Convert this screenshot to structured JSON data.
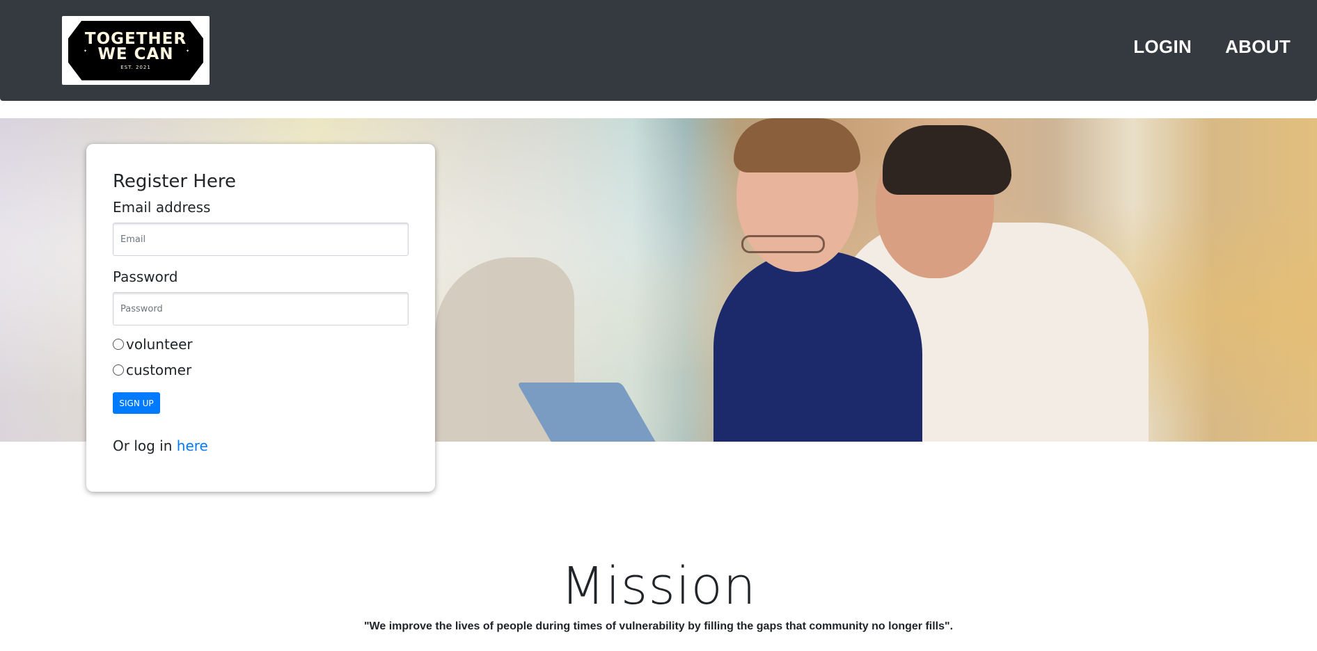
{
  "navbar": {
    "logo": {
      "line1": "TOGETHER",
      "line2": "WE CAN",
      "est": "EST. 2021"
    },
    "links": [
      {
        "label": "LOGIN"
      },
      {
        "label": "ABOUT"
      }
    ]
  },
  "register": {
    "title": "Register Here",
    "email_label": "Email address",
    "email_placeholder": "Email",
    "email_value": "",
    "password_label": "Password",
    "password_placeholder": "Password",
    "password_value": "",
    "roles": [
      {
        "label": "volunteer",
        "checked": false
      },
      {
        "label": "customer",
        "checked": false
      }
    ],
    "signup_label": "SIGN UP",
    "login_prefix": "Or log in ",
    "login_link": "here"
  },
  "mission": {
    "title": "Mission",
    "quote": "\"We improve the lives of people during times of vulnerability by filling the gaps that community no longer fills\"."
  },
  "colors": {
    "navbar_bg": "#343a40",
    "primary": "#007bff",
    "text": "#212529"
  }
}
